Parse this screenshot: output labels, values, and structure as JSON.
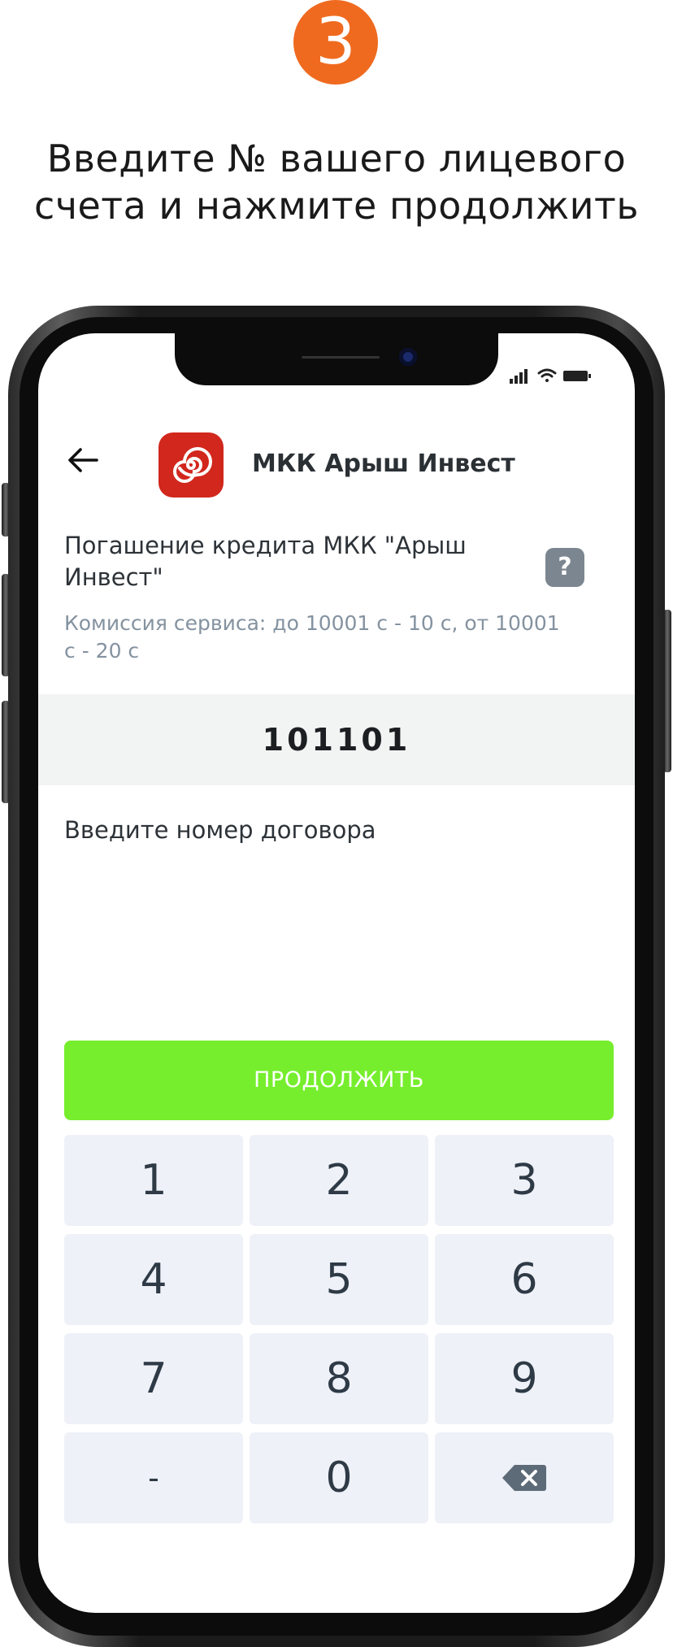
{
  "step": {
    "number": "3"
  },
  "instruction": {
    "line1": "Введите № вашего лицевого",
    "line2": "счета и нажмите продолжить"
  },
  "header": {
    "title": "МКК Арыш Инвест",
    "back_icon": "arrow-left-icon",
    "logo_icon": "spiral-logo-icon"
  },
  "service": {
    "title": "Погашение кредита МКК \"Арыш Инвест\"",
    "help_label": "?",
    "commission": "Комиссия сервиса: до 10001 с - 10 с, от 10001 с - 20 с"
  },
  "account_input": {
    "value": "101101",
    "hint": "Введите номер договора"
  },
  "continue_button": {
    "label": "ПРОДОЛЖИТЬ"
  },
  "keypad": {
    "keys": [
      "1",
      "2",
      "3",
      "4",
      "5",
      "6",
      "7",
      "8",
      "9",
      "-",
      "0"
    ],
    "backspace_icon": "backspace-icon"
  },
  "colors": {
    "step_badge": "#ef6a1f",
    "continue_button": "#76ee2d",
    "logo": "#d1271d",
    "help_button": "#7b8690",
    "key_background": "#eef1f7"
  }
}
